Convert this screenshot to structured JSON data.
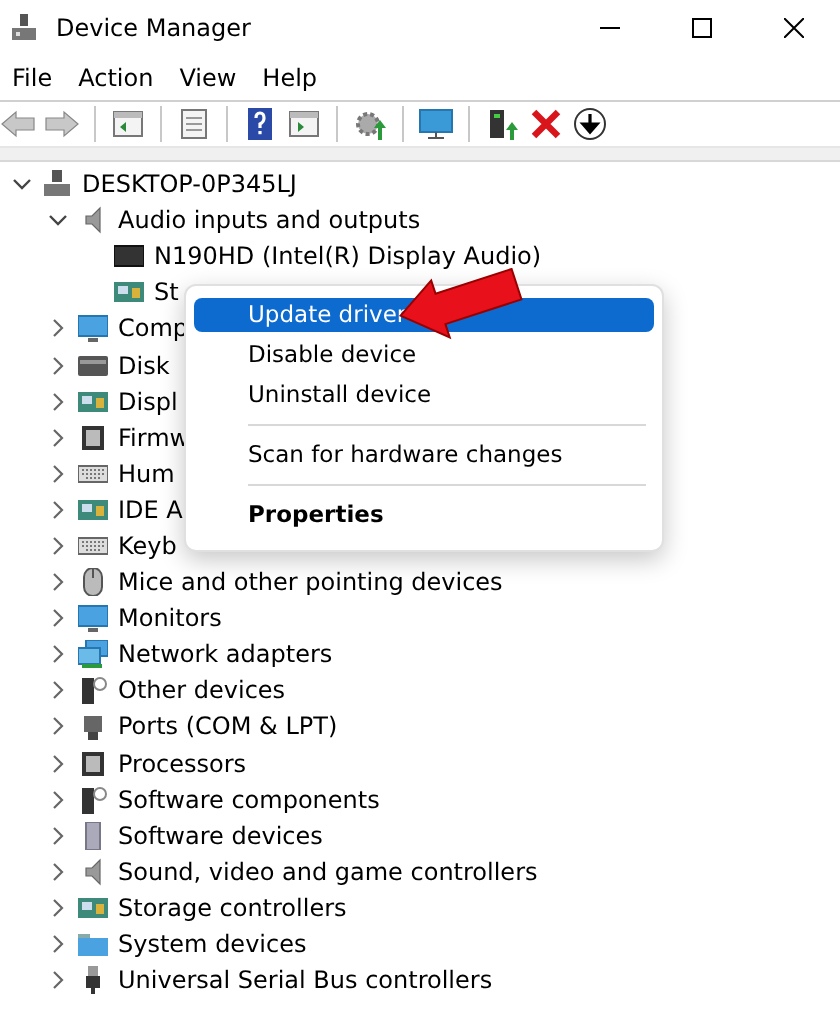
{
  "window": {
    "title": "Device Manager"
  },
  "menu_bar": [
    "File",
    "Action",
    "View",
    "Help"
  ],
  "toolbar": [
    {
      "kind": "back",
      "disabled": true
    },
    {
      "kind": "forward",
      "disabled": true
    },
    {
      "kind": "separator"
    },
    {
      "kind": "panel"
    },
    {
      "kind": "separator"
    },
    {
      "kind": "properties"
    },
    {
      "kind": "separator"
    },
    {
      "kind": "help"
    },
    {
      "kind": "panel2"
    },
    {
      "kind": "separator"
    },
    {
      "kind": "scan"
    },
    {
      "kind": "separator"
    },
    {
      "kind": "monitor"
    },
    {
      "kind": "separator"
    },
    {
      "kind": "update"
    },
    {
      "kind": "uninstall"
    },
    {
      "kind": "download"
    }
  ],
  "tree": [
    {
      "label": "DESKTOP-0P345LJ",
      "kind": "computer",
      "expanded": true,
      "children": [
        {
          "label": "Audio inputs and outputs",
          "kind": "speaker",
          "expanded": true,
          "children": [
            {
              "label": "N190HD (Intel(R) Display Audio)",
              "kind": "display"
            },
            {
              "label": "St",
              "kind": "card"
            }
          ]
        },
        {
          "label": "Comp",
          "kind": "monitor",
          "expanded": false
        },
        {
          "label": "Disk",
          "kind": "disk",
          "expanded": false
        },
        {
          "label": "Displ",
          "kind": "card",
          "expanded": false
        },
        {
          "label": "Firmw",
          "kind": "chip",
          "expanded": false
        },
        {
          "label": "Hum",
          "kind": "keyboard",
          "expanded": false
        },
        {
          "label": "IDE A",
          "kind": "card",
          "expanded": false
        },
        {
          "label": "Keyb",
          "kind": "keyboard",
          "expanded": false
        },
        {
          "label": "Mice and other pointing devices",
          "kind": "mouse",
          "expanded": false
        },
        {
          "label": "Monitors",
          "kind": "monitor",
          "expanded": false
        },
        {
          "label": "Network adapters",
          "kind": "network",
          "expanded": false
        },
        {
          "label": "Other devices",
          "kind": "other",
          "expanded": false
        },
        {
          "label": "Ports (COM & LPT)",
          "kind": "port",
          "expanded": false
        },
        {
          "label": "Processors",
          "kind": "chip",
          "expanded": false
        },
        {
          "label": "Software components",
          "kind": "other",
          "expanded": false
        },
        {
          "label": "Software devices",
          "kind": "tower",
          "expanded": false
        },
        {
          "label": "Sound, video and game controllers",
          "kind": "speaker",
          "expanded": false
        },
        {
          "label": "Storage controllers",
          "kind": "card",
          "expanded": false
        },
        {
          "label": "System devices",
          "kind": "folder",
          "expanded": false
        },
        {
          "label": "Universal Serial Bus controllers",
          "kind": "usb",
          "expanded": false
        }
      ]
    }
  ],
  "context_menu": [
    {
      "kind": "item",
      "label": "Update driver",
      "selected": true,
      "bold": false
    },
    {
      "kind": "item",
      "label": "Disable device",
      "selected": false,
      "bold": false
    },
    {
      "kind": "item",
      "label": "Uninstall device",
      "selected": false,
      "bold": false
    },
    {
      "kind": "separator"
    },
    {
      "kind": "item",
      "label": "Scan for hardware changes",
      "selected": false,
      "bold": false
    },
    {
      "kind": "separator"
    },
    {
      "kind": "item",
      "label": "Properties",
      "selected": false,
      "bold": true
    }
  ]
}
